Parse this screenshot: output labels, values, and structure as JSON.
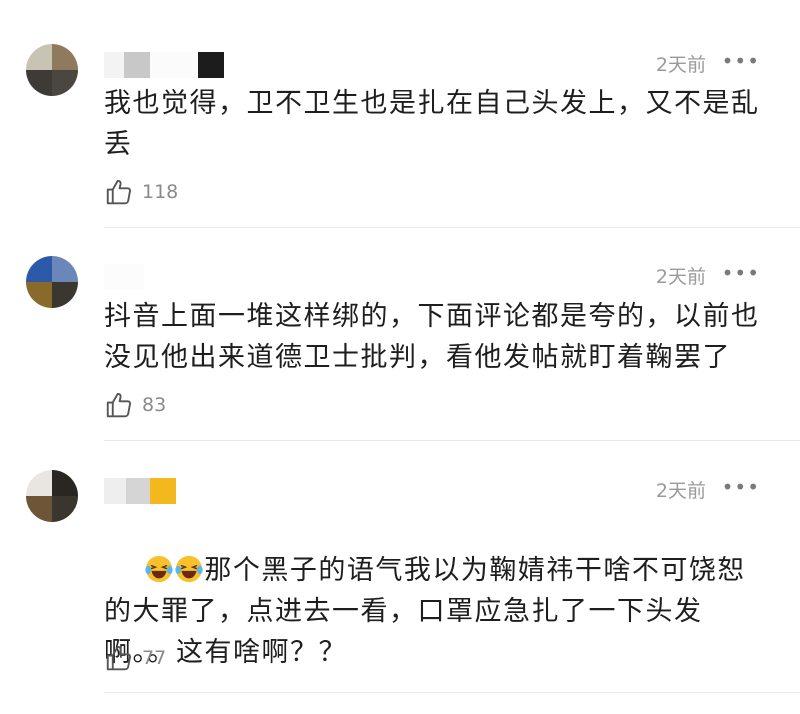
{
  "comments": [
    {
      "time": "2天前",
      "more": "•••",
      "text": "我也觉得，卫不卫生也是扎在自己头发上，又不是乱丢",
      "likes": "118"
    },
    {
      "time": "2天前",
      "more": "•••",
      "text": "抖音上面一堆这样绑的，下面评论都是夸的，以前也没见他出来道德卫士批判，看他发帖就盯着鞠罢了",
      "likes": "83"
    },
    {
      "time": "2天前",
      "more": "•••",
      "emoji": "laughing-tears-emoji",
      "text": "那个黑子的语气我以为鞠婧祎干啥不可饶恕的大罪了，点进去一看，口罩应急扎了一下头发啊。。这有啥啊？？",
      "likes": "77"
    }
  ],
  "icons": {
    "like": "thumbs-up-icon",
    "more": "more-dots-icon"
  },
  "colors": {
    "text": "#1e1e1e",
    "meta": "#9a9a9a",
    "divider": "#e8e8e8"
  }
}
